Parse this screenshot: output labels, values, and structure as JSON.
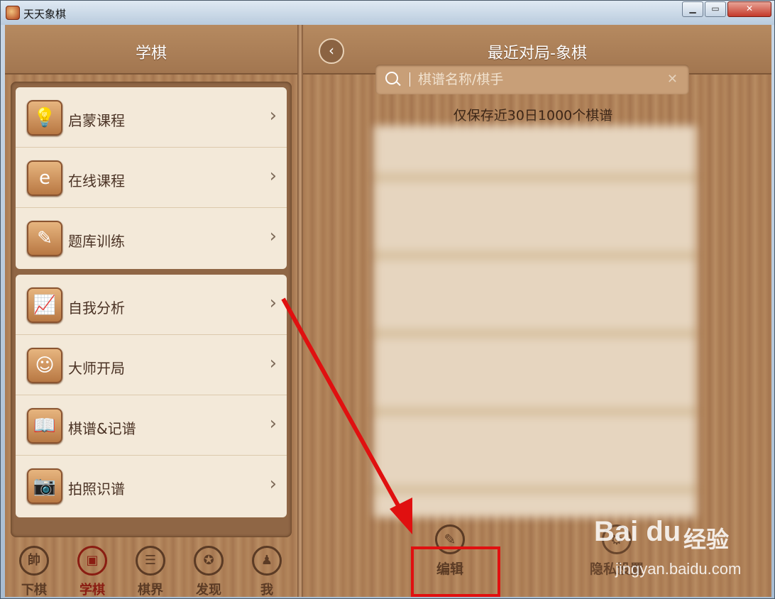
{
  "window": {
    "title": "天天象棋",
    "min_label": "▁",
    "max_label": "▭",
    "close_label": "✕"
  },
  "left": {
    "header_title": "学棋",
    "group1": [
      {
        "label": "启蒙课程",
        "icon": "lightbulb-icon",
        "glyph": "💡"
      },
      {
        "label": "在线课程",
        "icon": "browser-e-icon",
        "glyph": "e"
      },
      {
        "label": "题库训练",
        "icon": "checklist-pencil-icon",
        "glyph": "✎"
      }
    ],
    "group2": [
      {
        "label": "自我分析",
        "icon": "chart-analysis-icon",
        "glyph": "📈"
      },
      {
        "label": "大师开局",
        "icon": "master-face-icon",
        "glyph": "☺"
      },
      {
        "label": "棋谱&记谱",
        "icon": "book-icon",
        "glyph": "📖"
      },
      {
        "label": "拍照识谱",
        "icon": "camera-icon",
        "glyph": "📷"
      }
    ],
    "arrow": "›"
  },
  "tabs": [
    {
      "label": "下棋",
      "glyph": "帥",
      "icon": "play-chess-icon",
      "active": false
    },
    {
      "label": "学棋",
      "glyph": "▣",
      "icon": "learn-icon",
      "active": true
    },
    {
      "label": "棋界",
      "glyph": "☰",
      "icon": "community-icon",
      "active": false
    },
    {
      "label": "发现",
      "glyph": "✪",
      "icon": "compass-icon",
      "active": false
    },
    {
      "label": "我",
      "glyph": "♟",
      "icon": "profile-icon",
      "active": false
    }
  ],
  "right": {
    "header_title": "最近对局-象棋",
    "back_glyph": "‹",
    "search_placeholder": "棋谱名称/棋手",
    "clear_glyph": "✕",
    "save_note": "仅保存近30日1000个棋谱",
    "edit_label": "编辑",
    "edit_glyph": "✎",
    "privacy_label": "隐私设置",
    "privacy_glyph": "⚙"
  },
  "watermark": {
    "logo": "Bai du",
    "cn": "经验",
    "url": "jingyan.baidu.com"
  },
  "colors": {
    "highlight": "#e01010",
    "wood": "#a97a52"
  }
}
